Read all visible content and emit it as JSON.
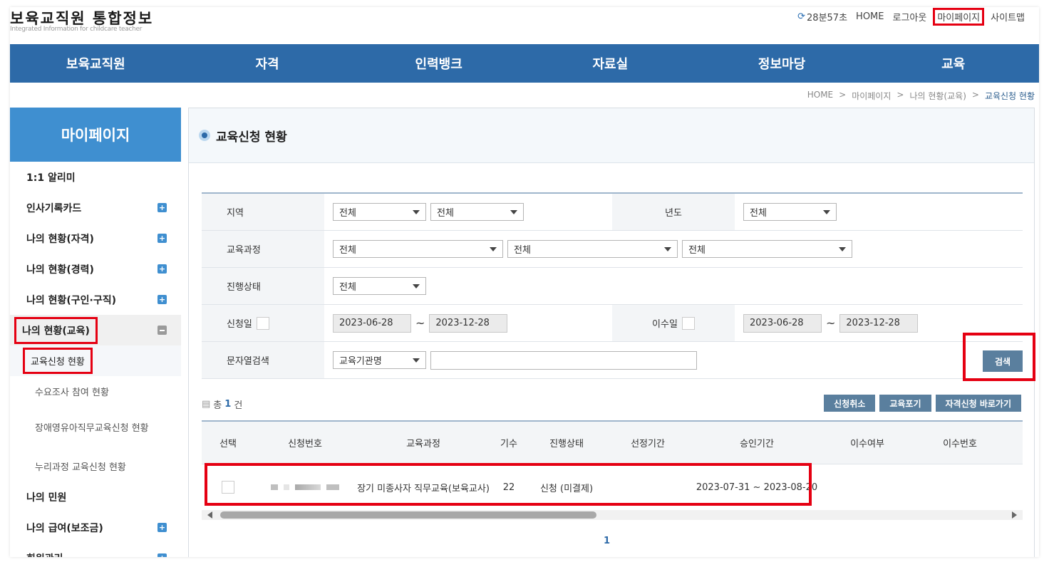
{
  "header": {
    "title": "보육교직원 통합정보",
    "subtitle": "Integrated Information for childcare teacher",
    "timer": "28분57초",
    "links": {
      "home": "HOME",
      "logout": "로그아웃",
      "mypage": "마이페이지",
      "sitemap": "사이트맵"
    }
  },
  "gnb": [
    "보육교직원",
    "자격",
    "인력뱅크",
    "자료실",
    "정보마당",
    "교육"
  ],
  "breadcrumb": [
    "HOME",
    ">",
    "마이페이지",
    ">",
    "나의 현황(교육)",
    ">",
    "교육신청 현황"
  ],
  "sidebar": {
    "title": "마이페이지",
    "items": [
      {
        "label": "1:1 알리미"
      },
      {
        "label": "인사기록카드"
      },
      {
        "label": "나의 현황(자격)"
      },
      {
        "label": "나의 현황(경력)"
      },
      {
        "label": "나의 현황(구인·구직)"
      },
      {
        "label": "나의 현황(교육)"
      },
      {
        "label": "나의 민원"
      },
      {
        "label": "나의 급여(보조금)"
      },
      {
        "label": "회원관리"
      }
    ],
    "sub": [
      {
        "label": "교육신청 현황"
      },
      {
        "label": "수요조사 참여 현황"
      },
      {
        "label": "장애영유아직무교육신청 현황"
      },
      {
        "label": "누리과정 교육신청 현황"
      }
    ]
  },
  "main": {
    "title": "교육신청 현황",
    "form": {
      "region_label": "지역",
      "region1": "전체",
      "region2": "전체",
      "year_label": "년도",
      "year": "전체",
      "course_label": "교육과정",
      "course1": "전체",
      "course2": "전체",
      "course3": "전체",
      "status_label": "진행상태",
      "status": "전체",
      "apply_date_label": "신청일",
      "apply_from": "2023-06-28",
      "apply_to": "2023-12-28",
      "tilde": "~",
      "complete_date_label": "이수일",
      "complete_from": "2023-06-28",
      "complete_to": "2023-12-28",
      "keyword_label": "문자열검색",
      "keyword_type": "교육기관명",
      "search_button": "검색"
    },
    "count": {
      "prefix": "총",
      "value": "1",
      "suffix": "건"
    },
    "actions": {
      "cancel": "신청취소",
      "giveup": "교육포기",
      "qualify": "자격신청 바로가기"
    },
    "table": {
      "headers": [
        "선택",
        "신청번호",
        "교육과정",
        "기수",
        "진행상태",
        "선정기간",
        "승인기간",
        "이수여부",
        "이수번호"
      ],
      "rows": [
        {
          "course": "장기 미종사자 직무교육(보육교사)",
          "term": "22",
          "status": "신청 (미결제)",
          "selection": "",
          "approval": "2023-07-31 ~ 2023-08-20",
          "completed": "",
          "cert_no": ""
        }
      ]
    },
    "pager": "1"
  }
}
